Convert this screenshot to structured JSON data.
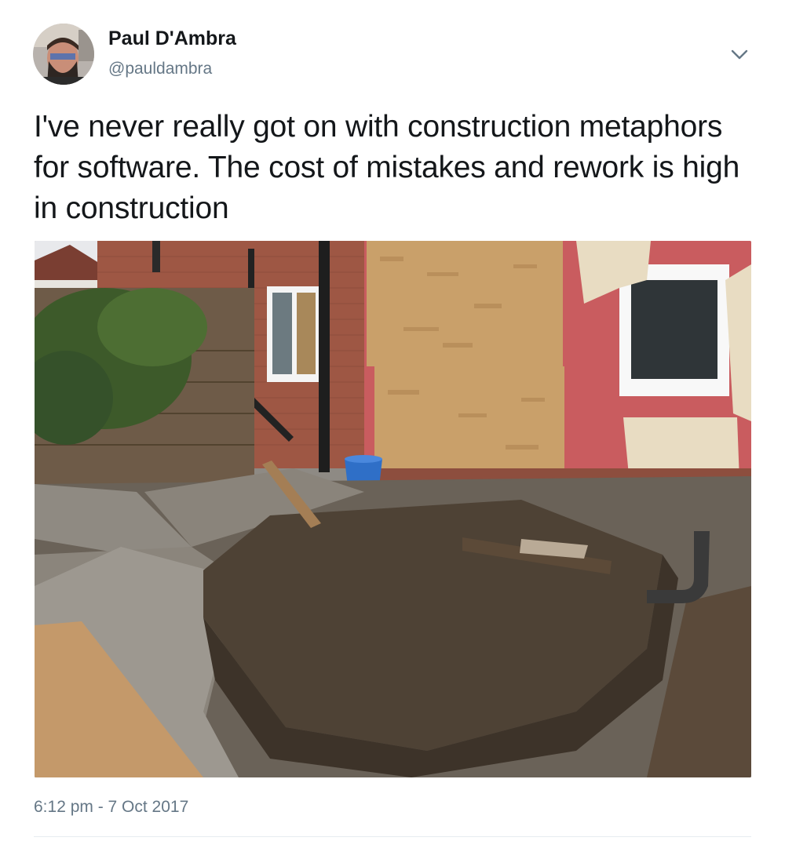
{
  "author": {
    "name": "Paul D'Ambra",
    "handle": "@pauldambra"
  },
  "tweet": {
    "text": "I've never really got on with construction metaphors for software. The cost of mistakes and rework is high in construction",
    "timestamp": "6:12 pm - 7 Oct 2017"
  },
  "icons": {
    "menu": "chevron-down-icon"
  },
  "colors": {
    "name_text": "#14171a",
    "secondary_text": "#657786",
    "caret": "#657786",
    "divider": "#e6ecf0"
  }
}
